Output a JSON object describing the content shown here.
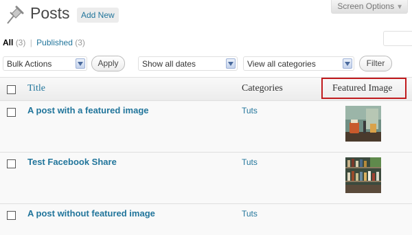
{
  "header": {
    "title": "Posts",
    "add_new_label": "Add New",
    "screen_options_label": "Screen Options",
    "screen_options_arrow": "▼"
  },
  "status_links": [
    {
      "label": "All",
      "count": "(3)",
      "current": true
    },
    {
      "label": "Published",
      "count": "(3)",
      "current": false
    }
  ],
  "status_separator": "|",
  "tablenav": {
    "bulk_actions": "Bulk Actions",
    "apply_label": "Apply",
    "dates": "Show all dates",
    "categories": "View all categories",
    "filter_label": "Filter"
  },
  "columns": {
    "title": "Title",
    "categories": "Categories",
    "featured_image": "Featured Image"
  },
  "rows": [
    {
      "title": "A post with a featured image",
      "category": "Tuts",
      "thumbnail": "bar-drinks-photo"
    },
    {
      "title": "Test Facebook Share",
      "category": "Tuts",
      "thumbnail": "bottle-shelf-photo"
    },
    {
      "title": "A post without featured image",
      "category": "Tuts",
      "thumbnail": null
    }
  ],
  "colors": {
    "link": "#21759b",
    "highlight_border": "#c0191c"
  }
}
